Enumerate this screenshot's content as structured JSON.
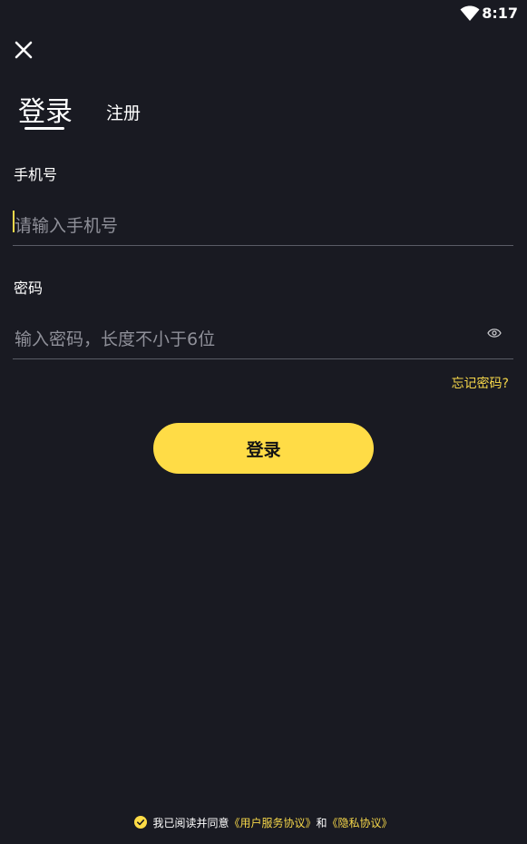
{
  "status_bar": {
    "time": "8:17",
    "icon": "wifi-icon"
  },
  "header": {
    "close_icon": "close-icon"
  },
  "tabs": {
    "login_label": "登录",
    "register_label": "注册",
    "active": "login"
  },
  "phone_field": {
    "label": "手机号",
    "placeholder": "请输入手机号",
    "value": ""
  },
  "password_field": {
    "label": "密码",
    "placeholder": "输入密码，长度不小于6位",
    "value": "",
    "toggle_icon": "eye-icon"
  },
  "forgot_password": "忘记密码?",
  "login_button": "登录",
  "agreement": {
    "checked": true,
    "prefix": "我已阅读并同意",
    "user_agreement": "《用户服务协议》",
    "conjunction": "和",
    "privacy_agreement": "《隐私协议》"
  },
  "colors": {
    "background": "#191a22",
    "accent": "#ffdc46",
    "link": "#f7d84a"
  }
}
